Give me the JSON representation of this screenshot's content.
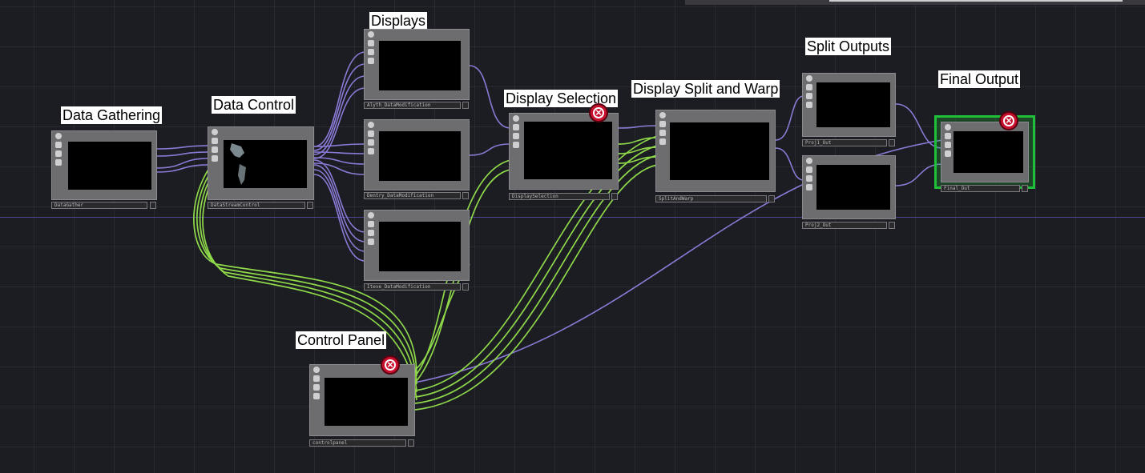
{
  "network": {
    "labels": {
      "data_gathering": "Data Gathering",
      "data_control": "Data Control",
      "displays": "Displays",
      "display_selection": "Display Selection",
      "display_split_warp": "Display Split and Warp",
      "split_outputs": "Split Outputs",
      "final_output": "Final Output",
      "control_panel": "Control Panel"
    },
    "nodes": {
      "datagather": "DataGather",
      "datastreamcontrol": "DataStreamControl",
      "display1": "Alyth_DataModification",
      "display2": "Dentry_DataModification",
      "display3": "Iteve_DataModification",
      "displayselection": "DisplaySelection",
      "splitandwarp": "SplitAndWarp",
      "proj1": "Proj1_Out",
      "proj2": "Proj2_Out",
      "final": "Final_Out",
      "controlpanel": "controlpanel"
    },
    "colors": {
      "background": "#1c1d22",
      "grid": "#2b2c32",
      "wire_top": "#8a7ad6",
      "wire_chop": "#8ed84a",
      "selected_outline": "#1fbf3a",
      "error": "#c8102e"
    },
    "icons": {
      "error": "error-x-icon",
      "node_toolbar": [
        "viewer-toggle-icon",
        "edit-icon",
        "bypass-icon",
        "lock-icon"
      ]
    }
  }
}
